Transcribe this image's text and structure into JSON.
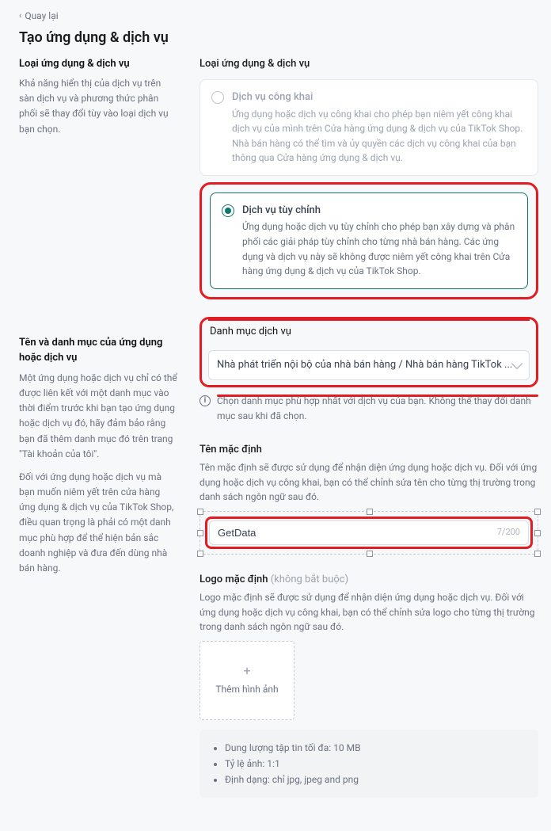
{
  "back_label": "Quay lại",
  "page_title": "Tạo ứng dụng & dịch vụ",
  "left": {
    "s1_heading": "Loại ứng dụng & dịch vụ",
    "s1_desc": "Khả năng hiển thị của dịch vụ trên sàn dịch vụ và phương thức phân phối sẽ thay đổi tùy vào loại dịch vụ bạn chọn.",
    "s2_heading": "Tên và danh mục của ứng dụng hoặc dịch vụ",
    "s2_desc1": "Một ứng dụng hoặc dịch vụ chỉ có thể được liên kết với một danh mục vào thời điểm trước khi bạn tạo ứng dụng hoặc dịch vụ đó, hãy đảm bảo rằng bạn đã thêm danh mục đó trên trang \"Tài khoản của tôi\".",
    "s2_desc2": "Đối với ứng dụng hoặc dịch vụ mà bạn muốn niêm yết trên cửa hàng ứng dụng & dịch vụ của TikTok Shop, điều quan trọng là phải có một danh mục phù hợp để thể hiện bản sắc doanh nghiệp và đưa đến dùng nhà bán hàng."
  },
  "type_block": {
    "heading": "Loại ứng dụng & dịch vụ",
    "public_title": "Dịch vụ công khai",
    "public_desc": "Ứng dụng hoặc dịch vụ công khai cho phép bạn niêm yết công khai dịch vụ của mình trên Cửa hàng ứng dụng & dịch vụ của TikTok Shop. Nhà bán hàng có thể tìm và ủy quyền các dịch vụ công khai của bạn thông qua Cửa hàng ứng dụng & dịch vụ.",
    "custom_title": "Dịch vụ tùy chỉnh",
    "custom_desc": "Ứng dụng hoặc dịch vụ tùy chỉnh cho phép bạn xây dựng và phân phối các giải pháp tùy chỉnh cho từng nhà bán hàng. Các ứng dụng và dịch vụ này sẽ không được niêm yết công khai trên Cửa hàng ứng dụng & dịch vụ của TikTok Shop."
  },
  "category_block": {
    "label": "Danh mục dịch vụ",
    "selected": "Nhà phát triển nội bộ của nhà bán hàng / Nhà bán hàng TikTok ...",
    "info": "Chọn danh mục phù hợp nhất với dịch vụ của bạn. Không thể thay đổi danh mục sau khi đã chọn."
  },
  "name_block": {
    "label": "Tên mặc định",
    "desc": "Tên mặc định sẽ được sử dụng để nhận diện ứng dụng hoặc dịch vụ. Đối với ứng dụng hoặc dịch vụ công khai, bạn có thể chỉnh sửa tên cho từng thị trường trong danh sách ngôn ngữ sau đó.",
    "value": "GetData",
    "counter": "7/200"
  },
  "logo_block": {
    "label": "Logo mặc định",
    "optional": "(không bắt buộc)",
    "desc": "Logo mặc định sẽ được sử dụng để nhận diện ứng dụng hoặc dịch vụ. Đối với ứng dụng hoặc dịch vụ công khai, bạn có thể chỉnh sửa logo cho từng thị trường trong danh sách ngôn ngữ sau đó.",
    "upload_label": "Thêm hình ảnh",
    "rules": [
      "Dung lượng tập tin tối đa: 10 MB",
      "Tỷ lệ ảnh: 1:1",
      "Định dạng: chỉ jpg, jpeg and png"
    ]
  }
}
